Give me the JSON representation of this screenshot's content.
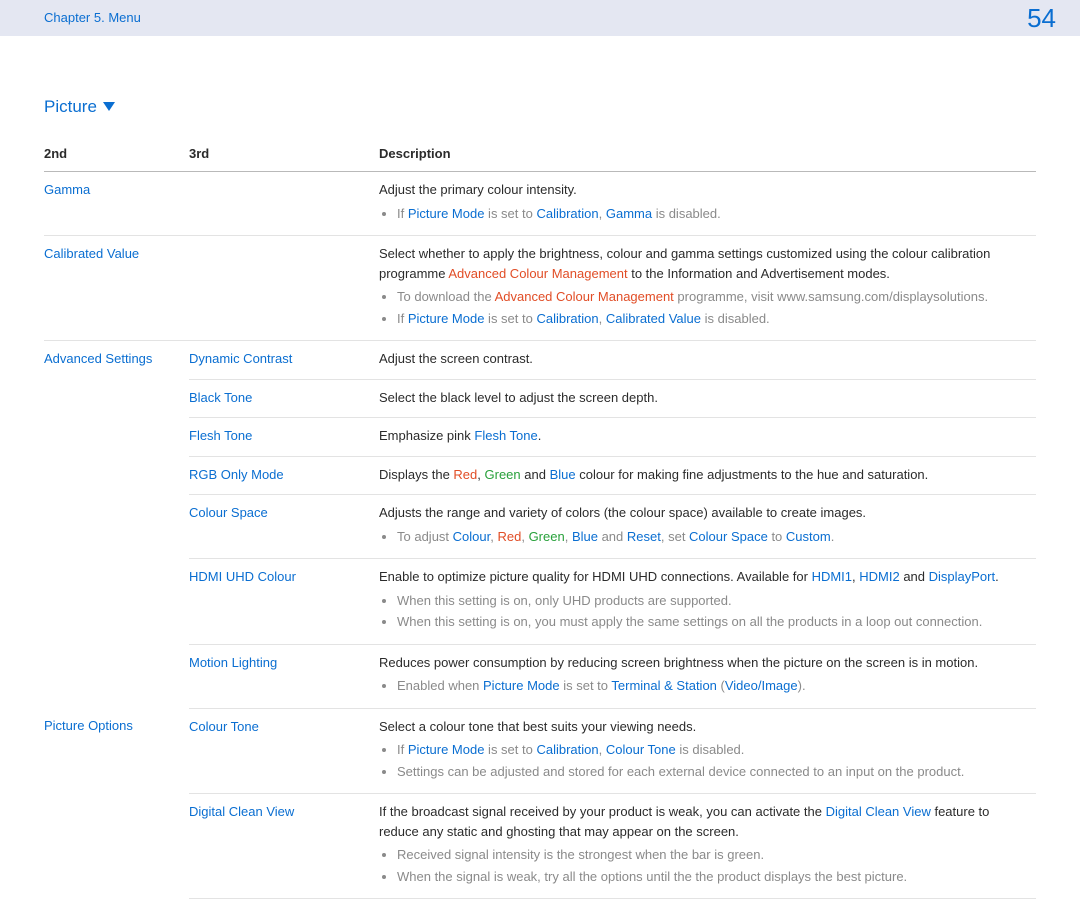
{
  "header": {
    "chapter": "Chapter 5. Menu",
    "page_number": "54"
  },
  "section_title": "Picture",
  "table": {
    "headers": {
      "col1": "2nd",
      "col2": "3rd",
      "col3": "Description"
    },
    "rows": {
      "gamma": {
        "second": "Gamma",
        "desc_main": "Adjust the primary colour intensity.",
        "b1_pre": "If ",
        "b1_pm": "Picture Mode",
        "b1_mid": " is set to ",
        "b1_cal": "Calibration",
        "b1_sep": ", ",
        "b1_gam": "Gamma",
        "b1_post": " is disabled."
      },
      "calibrated": {
        "second": "Calibrated Value",
        "d_l1_pre": "Select whether to apply the brightness, colour and gamma settings customized using the colour calibration programme ",
        "d_l1_acm": "Advanced Colour Management",
        "d_l1_post": " to the Information and Advertisement modes.",
        "b1_pre": "To download the ",
        "b1_acm": "Advanced Colour Management",
        "b1_post": " programme, visit www.samsung.com/displaysolutions.",
        "b2_pre": "If ",
        "b2_pm": "Picture Mode",
        "b2_mid": " is set to ",
        "b2_cal": "Calibration",
        "b2_sep": ", ",
        "b2_cv": "Calibrated Value",
        "b2_post": " is disabled."
      },
      "adv": {
        "second": "Advanced Settings",
        "dc": {
          "third": "Dynamic Contrast",
          "desc": "Adjust the screen contrast."
        },
        "bt": {
          "third": "Black Tone",
          "desc": "Select the black level to adjust the screen depth."
        },
        "ft": {
          "third": "Flesh Tone",
          "d_pre": "Emphasize pink ",
          "d_ft": "Flesh Tone",
          "d_post": "."
        },
        "rgb": {
          "third": "RGB Only Mode",
          "d_pre": "Displays the ",
          "d_red": "Red",
          "d_c1": ", ",
          "d_grn": "Green",
          "d_and": " and ",
          "d_blu": "Blue",
          "d_post": " colour for making fine adjustments to the hue and saturation."
        },
        "cs": {
          "third": "Colour Space",
          "desc_main": "Adjusts the range and variety of colors (the colour space) available to create images.",
          "b1_pre": "To adjust ",
          "b1_col": "Colour",
          "b1_c1": ", ",
          "b1_red": "Red",
          "b1_c2": ", ",
          "b1_grn": "Green",
          "b1_c3": ", ",
          "b1_blu": "Blue",
          "b1_and": " and ",
          "b1_rst": "Reset",
          "b1_set": ", set ",
          "b1_cs": "Colour Space",
          "b1_to": " to ",
          "b1_cust": "Custom",
          "b1_post": "."
        },
        "uhd": {
          "third": "HDMI UHD Colour",
          "d_pre": "Enable to optimize picture quality for HDMI UHD connections. Available for ",
          "d_h1": "HDMI1",
          "d_c1": ", ",
          "d_h2": "HDMI2",
          "d_and": " and ",
          "d_dp": "DisplayPort",
          "d_post": ".",
          "b1": "When this setting is on, only UHD products are supported.",
          "b2": "When this setting is on, you must apply the same settings on all the products in a loop out connection."
        },
        "ml": {
          "third": "Motion Lighting",
          "desc_main": "Reduces power consumption by reducing screen brightness when the picture on the screen is in motion.",
          "b1_pre": "Enabled when ",
          "b1_pm": "Picture Mode",
          "b1_mid": " is set to ",
          "b1_ts": "Terminal & Station",
          "b1_sp": " (",
          "b1_vi": "Video/Image",
          "b1_post": ")."
        }
      },
      "po": {
        "second": "Picture Options",
        "ct": {
          "third": "Colour Tone",
          "desc_main": "Select a colour tone that best suits your viewing needs.",
          "b1_pre": "If ",
          "b1_pm": "Picture Mode",
          "b1_mid": " is set to ",
          "b1_cal": "Calibration",
          "b1_sep": ", ",
          "b1_ct": "Colour Tone",
          "b1_post": " is disabled.",
          "b2": "Settings can be adjusted and stored for each external device connected to an input on the product."
        },
        "dcv": {
          "third": "Digital Clean View",
          "d_pre": "If the broadcast signal received by your product is weak, you can activate the ",
          "d_dcv": "Digital Clean View",
          "d_post": " feature to reduce any static and ghosting that may appear on the screen.",
          "b1": "Received signal intensity is the strongest when the bar is green.",
          "b2": "When the signal is weak, try all the options until the the product displays the best picture."
        }
      }
    }
  }
}
